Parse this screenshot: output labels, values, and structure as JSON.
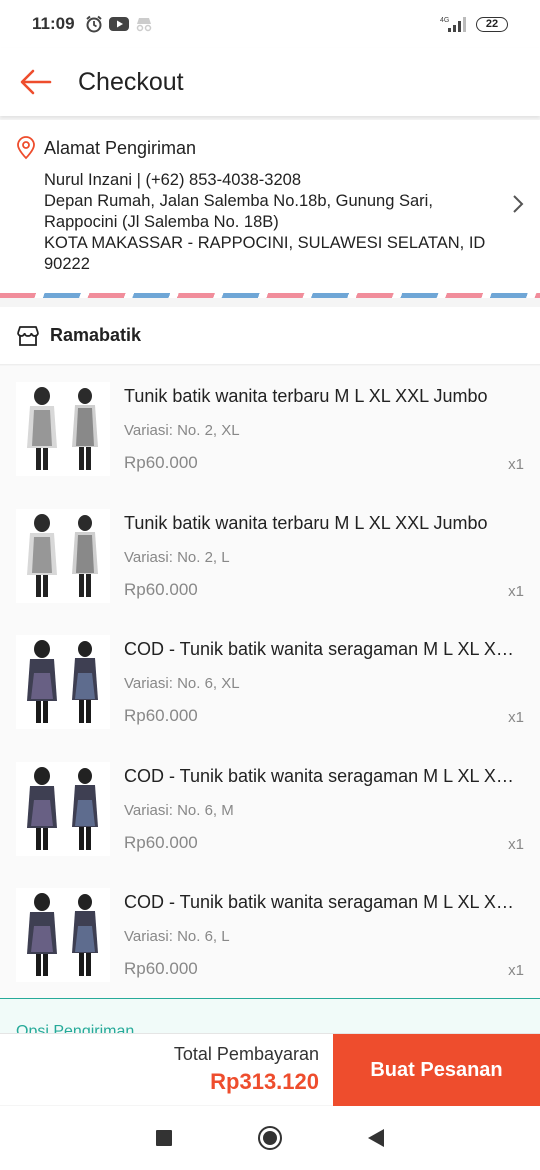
{
  "status_bar": {
    "time": "11:09",
    "network": "4G",
    "battery": "22"
  },
  "header": {
    "title": "Checkout"
  },
  "address": {
    "heading": "Alamat Pengiriman",
    "lines": [
      "Nurul Inzani | (+62) 853-4038-3208",
      "Depan Rumah, Jalan Salemba No.18b, Gunung Sari,",
      "Rappocini (Jl Salemba No. 18B)",
      "KOTA MAKASSAR - RAPPOCINI, SULAWESI SELATAN, ID",
      "90222"
    ]
  },
  "shop": {
    "name": "Ramabatik"
  },
  "items": [
    {
      "title": "Tunik batik wanita terbaru M L XL XXL Jumbo",
      "variation": "Variasi: No. 2, XL",
      "price": "Rp60.000",
      "qty": "x1"
    },
    {
      "title": "Tunik batik wanita terbaru M L XL XXL Jumbo",
      "variation": "Variasi: No. 2, L",
      "price": "Rp60.000",
      "qty": "x1"
    },
    {
      "title": "COD - Tunik batik wanita seragaman M L XL XXL Jumbo",
      "variation": "Variasi: No. 6, XL",
      "price": "Rp60.000",
      "qty": "x1"
    },
    {
      "title": "COD - Tunik batik wanita seragaman M L XL XXL Jumbo",
      "variation": "Variasi: No. 6, M",
      "price": "Rp60.000",
      "qty": "x1"
    },
    {
      "title": "COD - Tunik batik wanita seragaman M L XL XXL Jumbo",
      "variation": "Variasi: No. 6, L",
      "price": "Rp60.000",
      "qty": "x1"
    }
  ],
  "shipping": {
    "label": "Opsi Pengiriman"
  },
  "footer": {
    "total_label": "Total Pembayaran",
    "total_value": "Rp313.120",
    "order_button": "Buat Pesanan"
  },
  "colors": {
    "accent": "#ee4d2d",
    "teal": "#26aa99"
  },
  "icons": [
    "back-arrow-icon",
    "location-pin-icon",
    "chevron-right-icon",
    "store-icon",
    "nav-recents-icon",
    "nav-home-icon",
    "nav-back-icon"
  ]
}
